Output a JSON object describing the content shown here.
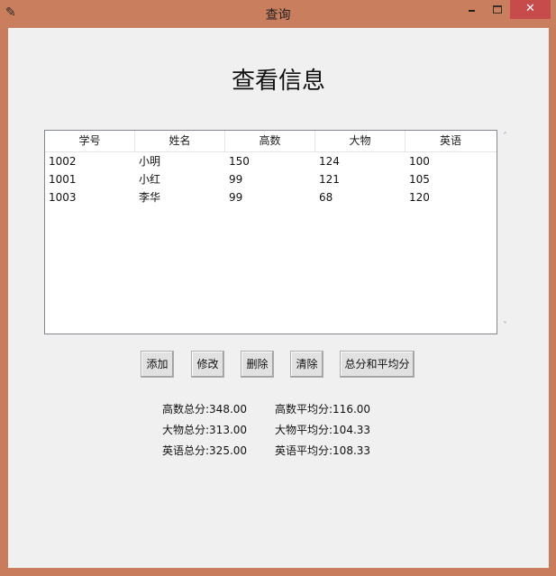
{
  "window": {
    "title": "查询",
    "minimize_glyph": "–",
    "maximize_glyph": "□",
    "close_glyph": "✕",
    "app_icon": "feather-icon"
  },
  "heading": "查看信息",
  "table": {
    "columns": [
      "学号",
      "姓名",
      "高数",
      "大物",
      "英语"
    ],
    "rows": [
      [
        "1002",
        "小明",
        "150",
        "124",
        "100"
      ],
      [
        "1001",
        "小红",
        "99",
        "121",
        "105"
      ],
      [
        "1003",
        "李华",
        "99",
        "68",
        "120"
      ]
    ]
  },
  "scrollbar": {
    "up_glyph": "˄",
    "down_glyph": "˅"
  },
  "buttons": {
    "add": "添加",
    "modify": "修改",
    "delete": "删除",
    "clear": "清除",
    "total_avg": "总分和平均分"
  },
  "stats": {
    "math_total": "高数总分:348.00",
    "math_avg": "高数平均分:116.00",
    "physics_total": "大物总分:313.00",
    "physics_avg": "大物平均分:104.33",
    "english_total": "英语总分:325.00",
    "english_avg": "英语平均分:108.33"
  },
  "colors": {
    "titlebar": "#c97e5d",
    "client_bg": "#f0f0f0",
    "close_button": "#c74b4b"
  }
}
